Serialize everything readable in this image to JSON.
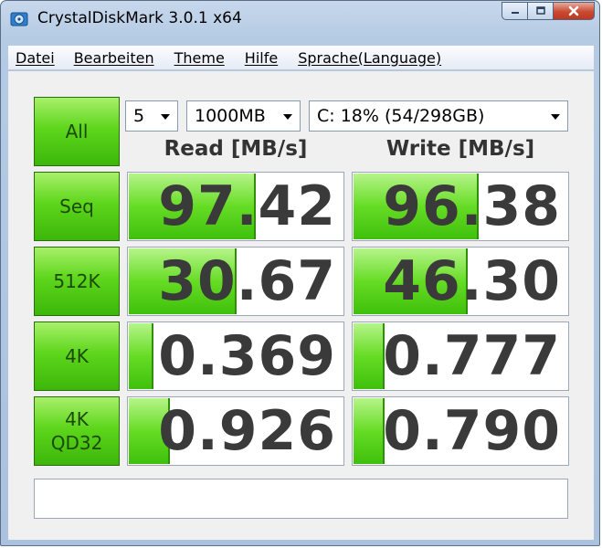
{
  "window": {
    "title": "CrystalDiskMark 3.0.1 x64"
  },
  "menu": [
    {
      "label": "Datei"
    },
    {
      "label": "Bearbeiten"
    },
    {
      "label": "Theme"
    },
    {
      "label": "Hilfe"
    },
    {
      "label": "Sprache(Language)"
    }
  ],
  "controls": {
    "all_label": "All",
    "count": "5",
    "size": "1000MB",
    "drive": "C: 18% (54/298GB)"
  },
  "headers": {
    "read": "Read [MB/s]",
    "write": "Write [MB/s]"
  },
  "rows": [
    {
      "label_line1": "Seq",
      "label_line2": "",
      "read": "97.42",
      "write": "96.38",
      "read_fill": 0.59,
      "write_fill": 0.58
    },
    {
      "label_line1": "512K",
      "label_line2": "",
      "read": "30.67",
      "write": "46.30",
      "read_fill": 0.5,
      "write_fill": 0.53
    },
    {
      "label_line1": "4K",
      "label_line2": "",
      "read": "0.369",
      "write": "0.777",
      "read_fill": 0.11,
      "write_fill": 0.14
    },
    {
      "label_line1": "4K",
      "label_line2": "QD32",
      "read": "0.926",
      "write": "0.790",
      "read_fill": 0.19,
      "write_fill": 0.14
    }
  ],
  "comment": "",
  "colors": {
    "accent_green": "#5ed61c",
    "value_text": "#3a3a3a",
    "close_red": "#c94a31"
  }
}
